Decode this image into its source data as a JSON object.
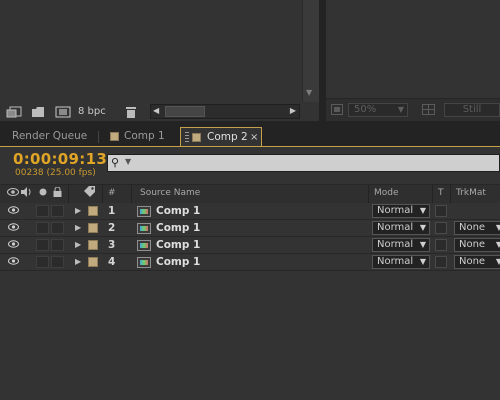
{
  "project_panel": {
    "bpc_label": "8 bpc"
  },
  "viewer": {
    "zoom_value": "50%",
    "resolution_value": "Still"
  },
  "tabs": [
    {
      "label": "Render Queue"
    },
    {
      "label": "Comp 1"
    },
    {
      "label": "Comp 2",
      "close": "×"
    }
  ],
  "timeline": {
    "timecode": "0:00:09:13",
    "frame_info": "00238 (25.00 fps)",
    "search_placeholder": ""
  },
  "columns": {
    "number": "#",
    "source_name": "Source Name",
    "mode": "Mode",
    "t": "T",
    "trkmat": "TrkMat"
  },
  "layers": [
    {
      "number": "1",
      "name": "Comp 1",
      "mode": "Normal",
      "trkmat": ""
    },
    {
      "number": "2",
      "name": "Comp 1",
      "mode": "Normal",
      "trkmat": "None"
    },
    {
      "number": "3",
      "name": "Comp 1",
      "mode": "Normal",
      "trkmat": "None"
    },
    {
      "number": "4",
      "name": "Comp 1",
      "mode": "Normal",
      "trkmat": "None"
    }
  ],
  "colors": {
    "timecode": "#e0a526",
    "active_tab_border": "#c3a24a",
    "label_swatch": "#c2aa7f"
  },
  "icons": [
    "interpret-footage-icon",
    "folder-icon",
    "new-comp-icon",
    "trash-icon",
    "eye-icon",
    "audio-icon",
    "solo-icon",
    "lock-icon",
    "label-tag-icon",
    "search-icon",
    "composition-icon"
  ]
}
